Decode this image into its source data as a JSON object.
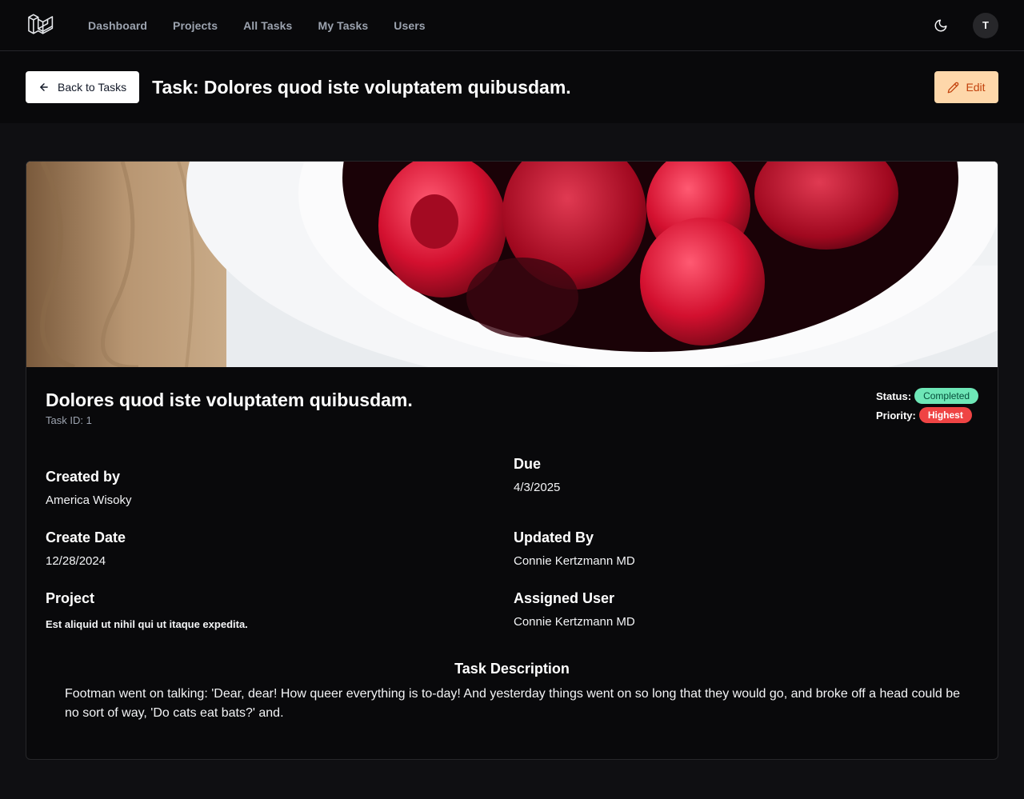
{
  "nav": {
    "logo_icon": "laravel-logo-icon",
    "links": [
      "Dashboard",
      "Projects",
      "All Tasks",
      "My Tasks",
      "Users"
    ],
    "theme_icon": "moon-icon",
    "avatar_initial": "T"
  },
  "header": {
    "back_label": "Back to Tasks",
    "back_icon": "arrow-left-icon",
    "title": "Task: Dolores quod iste voluptatem quibusdam.",
    "edit_label": "Edit",
    "edit_icon": "pencil-icon"
  },
  "task": {
    "name": "Dolores quod iste voluptatem quibusdam.",
    "id_text": "Task ID: 1",
    "status_label": "Status:",
    "status": "Completed",
    "priority_label": "Priority:",
    "priority": "Highest",
    "fields": {
      "created_by_label": "Created by",
      "created_by": "America Wisoky",
      "due_label": "Due",
      "due": "4/3/2025",
      "create_date_label": "Create Date",
      "create_date": "12/28/2024",
      "updated_by_label": "Updated By",
      "updated_by": "Connie Kertzmann MD",
      "project_label": "Project",
      "project": "Est aliquid ut nihil qui ut itaque expedita.",
      "assigned_user_label": "Assigned User",
      "assigned_user": "Connie Kertzmann MD"
    },
    "description_label": "Task Description",
    "description": "Footman went on talking: 'Dear, dear! How queer everything is to-day! And yesterday things went on so long that they would go, and broke off a head could be no sort of way, 'Do cats eat bats?' and."
  },
  "colors": {
    "status_bg": "#6ee7b7",
    "priority_bg": "#ef4444",
    "edit_bg": "#fed7aa"
  }
}
